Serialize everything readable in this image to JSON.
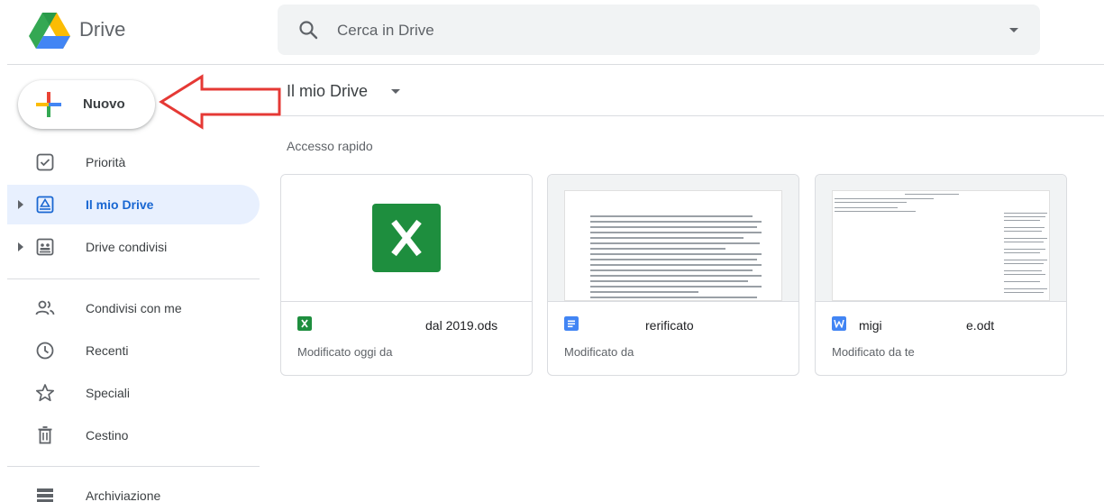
{
  "header": {
    "brand": "Drive",
    "search_placeholder": "Cerca in Drive"
  },
  "new_button": {
    "label": "Nuovo"
  },
  "sidebar": {
    "items": [
      {
        "label": "Priorità",
        "icon": "priority-icon"
      },
      {
        "label": "Il mio Drive",
        "icon": "my-drive-icon",
        "active": true
      },
      {
        "label": "Drive condivisi",
        "icon": "shared-drives-icon"
      },
      {
        "label": "Condivisi con me",
        "icon": "shared-with-me-icon"
      },
      {
        "label": "Recenti",
        "icon": "clock-icon"
      },
      {
        "label": "Speciali",
        "icon": "star-icon"
      },
      {
        "label": "Cestino",
        "icon": "trash-icon"
      },
      {
        "label": "Archiviazione",
        "icon": "storage-icon"
      }
    ]
  },
  "main": {
    "breadcrumb": "Il mio Drive",
    "quick_access_title": "Accesso rapido",
    "cards": [
      {
        "name": "dal 2019.ods",
        "meta": "Modificato oggi da",
        "type_letter": "X",
        "type_color": "#1e8e3e"
      },
      {
        "name": "rerificato",
        "meta": "Modificato da",
        "type_letter": "≡",
        "type_color": "#4285f4"
      },
      {
        "name": "migi                        e.odt",
        "meta": "Modificato da te",
        "type_letter": "W",
        "type_color": "#4285f4"
      }
    ]
  },
  "colors": {
    "accent": "#1967d2",
    "active_bg": "#e8f0fe",
    "annotation_arrow": "#e53935"
  }
}
